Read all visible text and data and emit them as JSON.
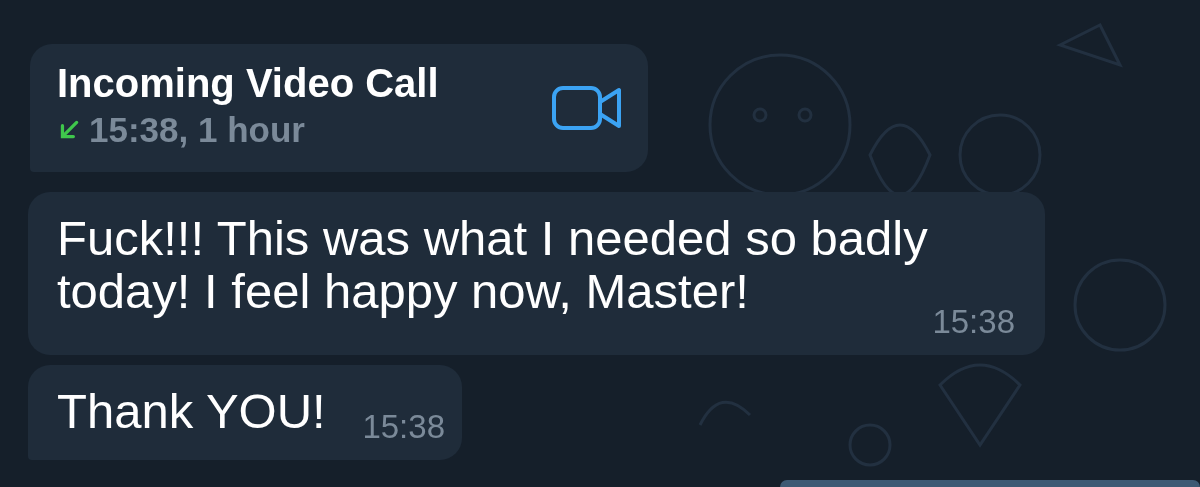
{
  "call": {
    "title": "Incoming Video Call",
    "details": "15:38, 1 hour"
  },
  "messages": [
    {
      "text": "Fuck!!! This was what I needed so badly today! I feel happy now, Master!",
      "time": "15:38"
    },
    {
      "text": "Thank YOU!",
      "time": "15:38"
    }
  ]
}
